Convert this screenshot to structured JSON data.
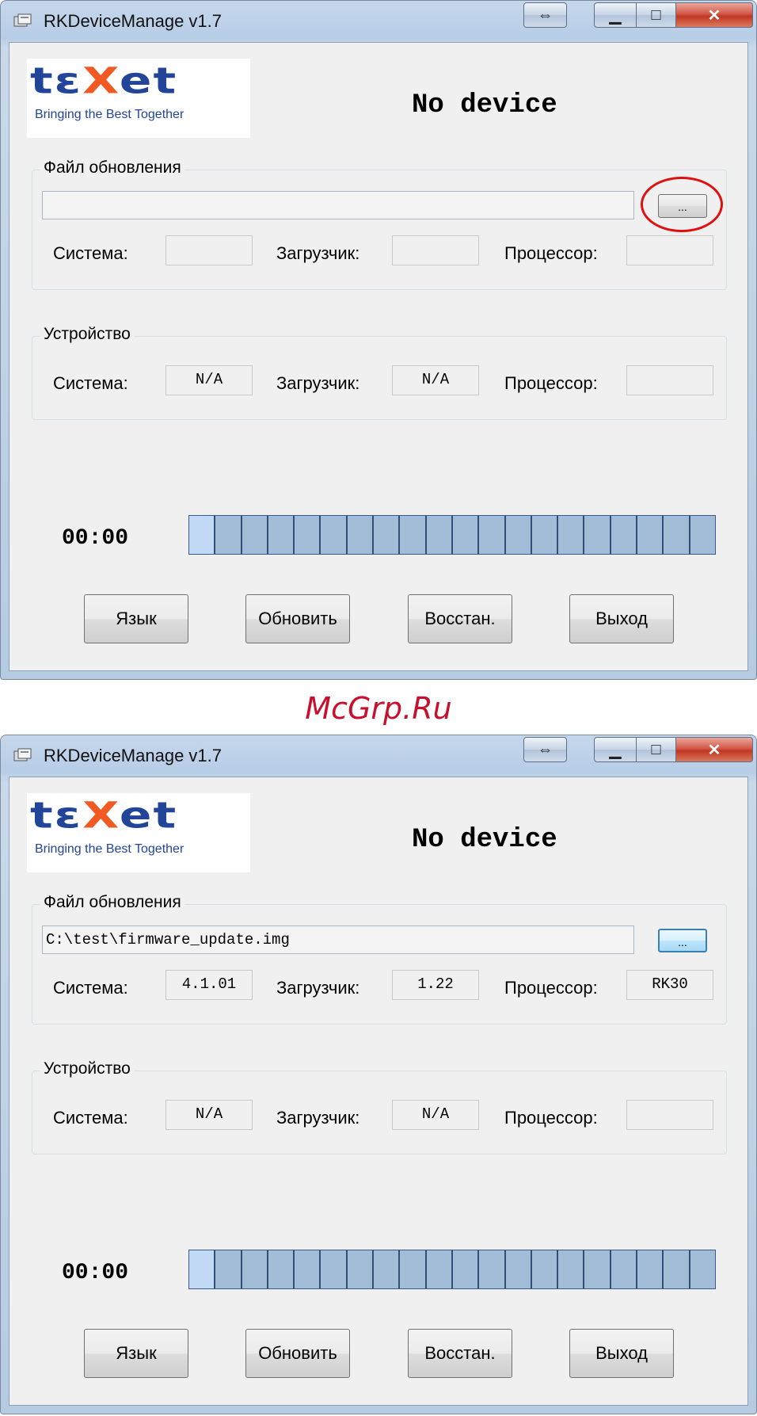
{
  "watermark": "McGrp.Ru",
  "screens": [
    {
      "title": "RKDeviceManage v1.7",
      "logo": {
        "wordmark_left": "t",
        "wordmark_accent": "e",
        "wordmark_x": "X",
        "wordmark_right": "et",
        "tagline": "Bringing the Best Together"
      },
      "status": "No device",
      "update_file": {
        "legend": "Файл обновления",
        "path": "",
        "browse_label": "...",
        "system_label": "Система:",
        "system_value": "",
        "loader_label": "Загрузчик:",
        "loader_value": "",
        "cpu_label": "Процессор:",
        "cpu_value": ""
      },
      "device": {
        "legend": "Устройство",
        "system_label": "Система:",
        "system_value": "N/A",
        "loader_label": "Загрузчик:",
        "loader_value": "N/A",
        "cpu_label": "Процессор:",
        "cpu_value": ""
      },
      "timer": "00:00",
      "progress": {
        "segments": 20,
        "active": 1
      },
      "buttons": {
        "language": "Язык",
        "update": "Обновить",
        "restore": "Восстан.",
        "exit": "Выход"
      },
      "browse_highlighted": true
    },
    {
      "title": "RKDeviceManage v1.7",
      "logo": {
        "tagline": "Bringing the Best Together"
      },
      "status": "No device",
      "update_file": {
        "legend": "Файл обновления",
        "path": "C:\\test\\firmware_update.img",
        "browse_label": "...",
        "system_label": "Система:",
        "system_value": "4.1.01",
        "loader_label": "Загрузчик:",
        "loader_value": "1.22",
        "cpu_label": "Процессор:",
        "cpu_value": "RK30"
      },
      "device": {
        "legend": "Устройство",
        "system_label": "Система:",
        "system_value": "N/A",
        "loader_label": "Загрузчик:",
        "loader_value": "N/A",
        "cpu_label": "Процессор:",
        "cpu_value": ""
      },
      "timer": "00:00",
      "progress": {
        "segments": 20,
        "active": 1
      },
      "buttons": {
        "language": "Язык",
        "update": "Обновить",
        "restore": "Восстан.",
        "exit": "Выход"
      },
      "browse_highlighted": false
    }
  ],
  "icons": {
    "app": "app-icon",
    "resize": "resize-arrows-icon",
    "minimize": "minimize-icon",
    "maximize": "maximize-icon",
    "close": "close-icon"
  }
}
